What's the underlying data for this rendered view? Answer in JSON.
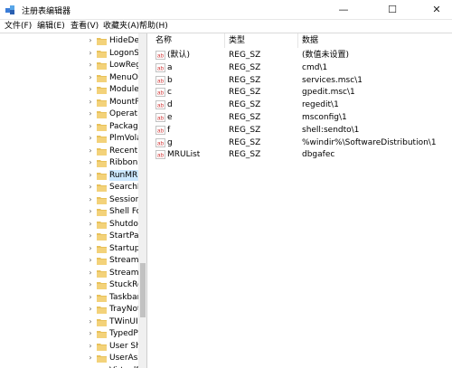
{
  "window": {
    "title": "注册表编辑器",
    "minimize_glyph": "—",
    "maximize_glyph": "☐",
    "close_glyph": "✕"
  },
  "menu": [
    "文件(F)",
    "编辑(E)",
    "查看(V)",
    "收藏夹(A)",
    "帮助(H)"
  ],
  "tree": {
    "items": [
      {
        "label": "HideDes"
      },
      {
        "label": "LogonS"
      },
      {
        "label": "LowReg"
      },
      {
        "label": "MenuO"
      },
      {
        "label": "Module"
      },
      {
        "label": "MountP"
      },
      {
        "label": "Operati"
      },
      {
        "label": "Package"
      },
      {
        "label": "PlmVola"
      },
      {
        "label": "RecentD"
      },
      {
        "label": "Ribbon"
      },
      {
        "label": "RunMRU"
      },
      {
        "label": "SearchP"
      },
      {
        "label": "Session"
      },
      {
        "label": "Shell Fo"
      },
      {
        "label": "Shutdov"
      },
      {
        "label": "StartPag"
      },
      {
        "label": "Startupa"
      },
      {
        "label": "StreamN"
      },
      {
        "label": "Streams"
      },
      {
        "label": "StuckRe"
      },
      {
        "label": "Taskbar"
      },
      {
        "label": "TrayNot"
      },
      {
        "label": "TWinUI"
      },
      {
        "label": "TypedPa"
      },
      {
        "label": "User Sh"
      },
      {
        "label": "UserAss"
      },
      {
        "label": "VirtualD"
      }
    ],
    "selected_index": 11
  },
  "columns": {
    "name": "名称",
    "type": "类型",
    "data": "数据"
  },
  "values": [
    {
      "name": "(默认)",
      "type": "REG_SZ",
      "data": "(数值未设置)"
    },
    {
      "name": "a",
      "type": "REG_SZ",
      "data": "cmd\\1"
    },
    {
      "name": "b",
      "type": "REG_SZ",
      "data": "services.msc\\1"
    },
    {
      "name": "c",
      "type": "REG_SZ",
      "data": "gpedit.msc\\1"
    },
    {
      "name": "d",
      "type": "REG_SZ",
      "data": "regedit\\1"
    },
    {
      "name": "e",
      "type": "REG_SZ",
      "data": "msconfig\\1"
    },
    {
      "name": "f",
      "type": "REG_SZ",
      "data": "shell:sendto\\1"
    },
    {
      "name": "g",
      "type": "REG_SZ",
      "data": "%windir%\\SoftwareDistribution\\1"
    },
    {
      "name": "MRUList",
      "type": "REG_SZ",
      "data": "dbgafec"
    }
  ],
  "icons": {
    "app": "registry-cubes-icon",
    "folder": "folder-icon",
    "value": "string-value-ab-icon",
    "expand": "chevron-right-icon"
  },
  "colors": {
    "folder": "#e8c15a",
    "value_icon": "#d23f3f",
    "selection": "#cce8ff"
  }
}
